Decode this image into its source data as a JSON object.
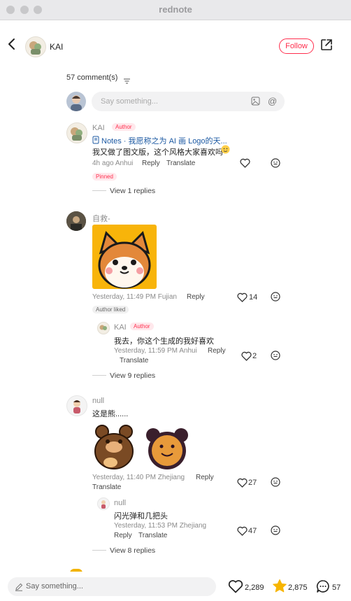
{
  "window": {
    "title": "rednote"
  },
  "header": {
    "username": "KAI",
    "follow_label": "Follow"
  },
  "comments_header": {
    "count_label": "57 comment(s)"
  },
  "compose": {
    "placeholder": "Say something..."
  },
  "comments": [
    {
      "author": "KAI",
      "author_tag": "Author",
      "note_link": "Notes · 我愿称之为 AI 画 Logo的天...",
      "text": "我又做了图文版，这个风格大家喜欢吗",
      "meta": "4h ago Anhui",
      "reply_label": "Reply",
      "translate_label": "Translate",
      "pinned_label": "Pinned",
      "view_replies": "View 1 replies"
    },
    {
      "author": "自救-",
      "meta": "Yesterday, 11:49 PM Fujian",
      "reply_label": "Reply",
      "likes": "14",
      "author_liked_label": "Author liked",
      "reply": {
        "author": "KAI",
        "author_tag": "Author",
        "text": "我去，你这个生成的我好喜欢",
        "meta": "Yesterday, 11:59 PM Anhui",
        "reply_label": "Reply",
        "translate_label": "Translate",
        "likes": "2"
      },
      "view_replies": "View 9 replies"
    },
    {
      "author": "null",
      "text": "这是熊......",
      "meta": "Yesterday, 11:40 PM Zhejiang",
      "reply_label": "Reply",
      "translate_label": "Translate",
      "likes": "27",
      "reply": {
        "author": "null",
        "text": "闪光弹和几把头",
        "meta": "Yesterday, 11:53 PM Zhejiang",
        "reply_label": "Reply",
        "translate_label": "Translate",
        "likes": "47"
      },
      "view_replies": "View 8 replies"
    }
  ],
  "bottom_bar": {
    "placeholder": "Say something...",
    "likes": "2,289",
    "stars": "2,875",
    "comments": "57"
  },
  "colors": {
    "accent": "#ff2e4d",
    "star": "#f7b500",
    "link": "#1d5aa3"
  }
}
